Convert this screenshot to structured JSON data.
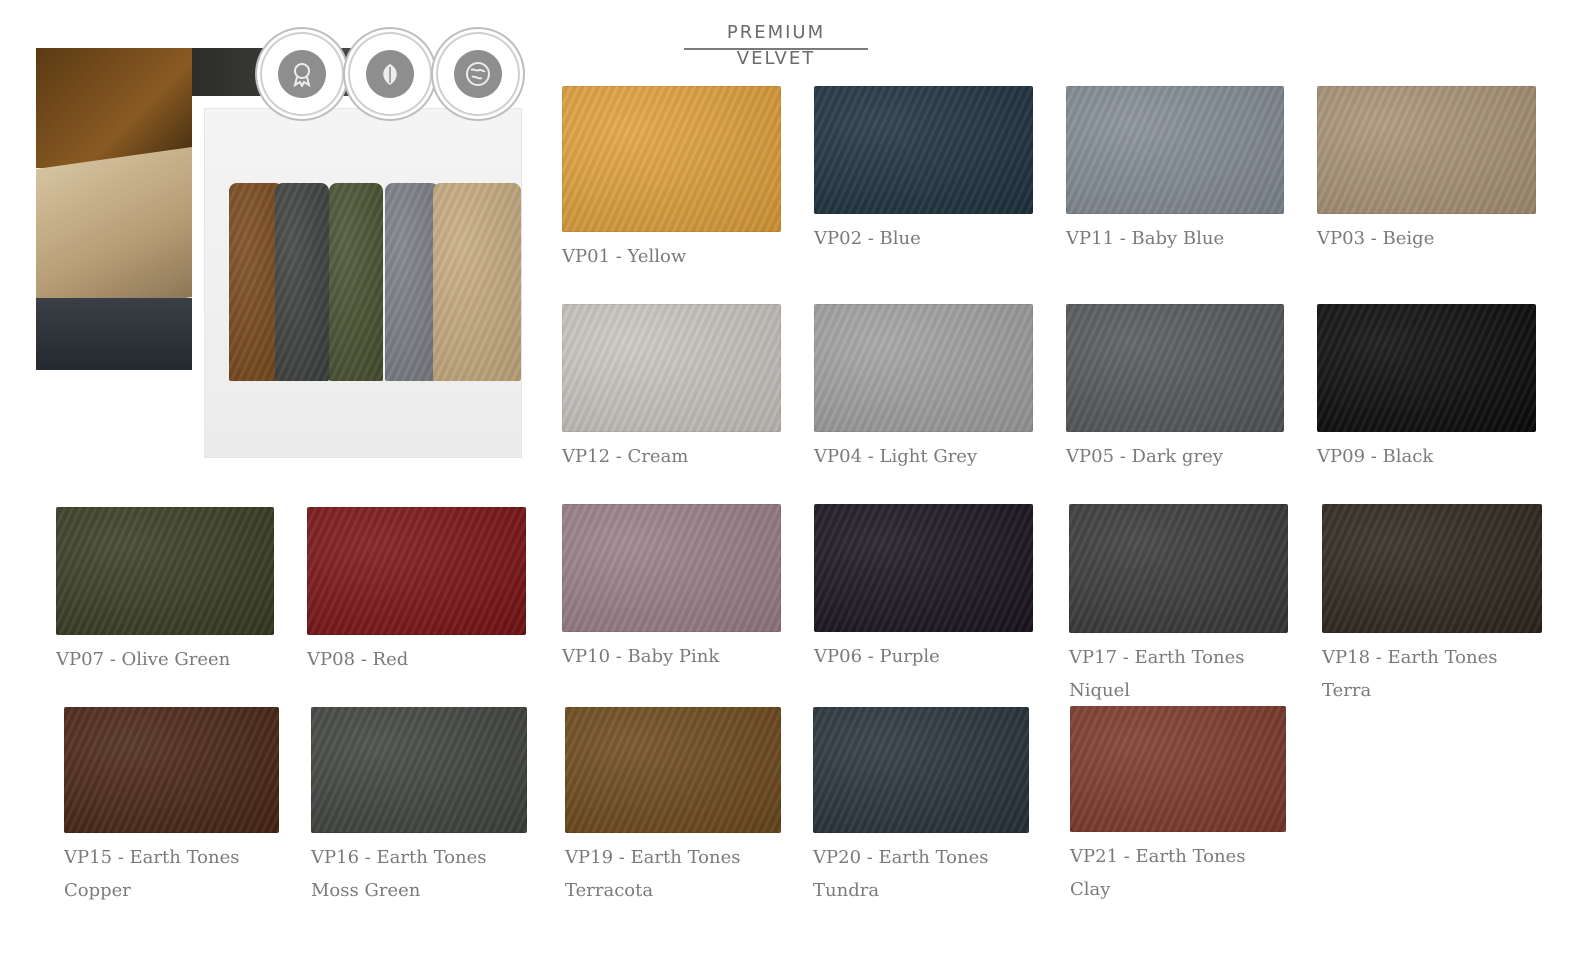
{
  "header": {
    "title": "PREMIUM VELVET"
  },
  "badges": [
    {
      "name": "premium-coating-badge-icon"
    },
    {
      "name": "vegan-leaf-badge-icon"
    },
    {
      "name": "eco-friendly-globe-badge-icon"
    }
  ],
  "swatches": [
    {
      "label": "VP01 - Yellow",
      "color": "#e3a23d"
    },
    {
      "label": "VP02 - Blue",
      "color": "#203340"
    },
    {
      "label": "VP11 - Baby Blue",
      "color": "#848d96"
    },
    {
      "label": "VP03 - Beige",
      "color": "#ab9478"
    },
    {
      "label": "VP12 - Cream",
      "color": "#cbc7c1"
    },
    {
      "label": "VP04 - Light Grey",
      "color": "#a2a2a4"
    },
    {
      "label": "VP05 - Dark grey",
      "color": "#56585c"
    },
    {
      "label": "VP09 - Black",
      "color": "#0b0b0d"
    },
    {
      "label": "VP07 - Olive Green",
      "color": "#393d23"
    },
    {
      "label": "VP08 - Red",
      "color": "#7c1416"
    },
    {
      "label": "VP10 - Baby Pink",
      "color": "#9b8089"
    },
    {
      "label": "VP06 - Purple",
      "color": "#1b1420"
    },
    {
      "label": "VP17 - Earth Tones Niquel",
      "color": "#3a3a3c"
    },
    {
      "label": "VP18 - Earth Tones Terra",
      "color": "#2f271d"
    },
    {
      "label": "VP15 - Earth Tones Copper",
      "color": "#4a2615"
    },
    {
      "label": "VP16 - Earth Tones Moss Green",
      "color": "#41443f"
    },
    {
      "label": "VP19 - Earth Tones Terracota",
      "color": "#6e4a1c"
    },
    {
      "label": "VP20 - Earth Tones Tundra",
      "color": "#28333a"
    },
    {
      "label": "VP21 - Earth Tones Clay",
      "color": "#7e3a2c"
    }
  ]
}
